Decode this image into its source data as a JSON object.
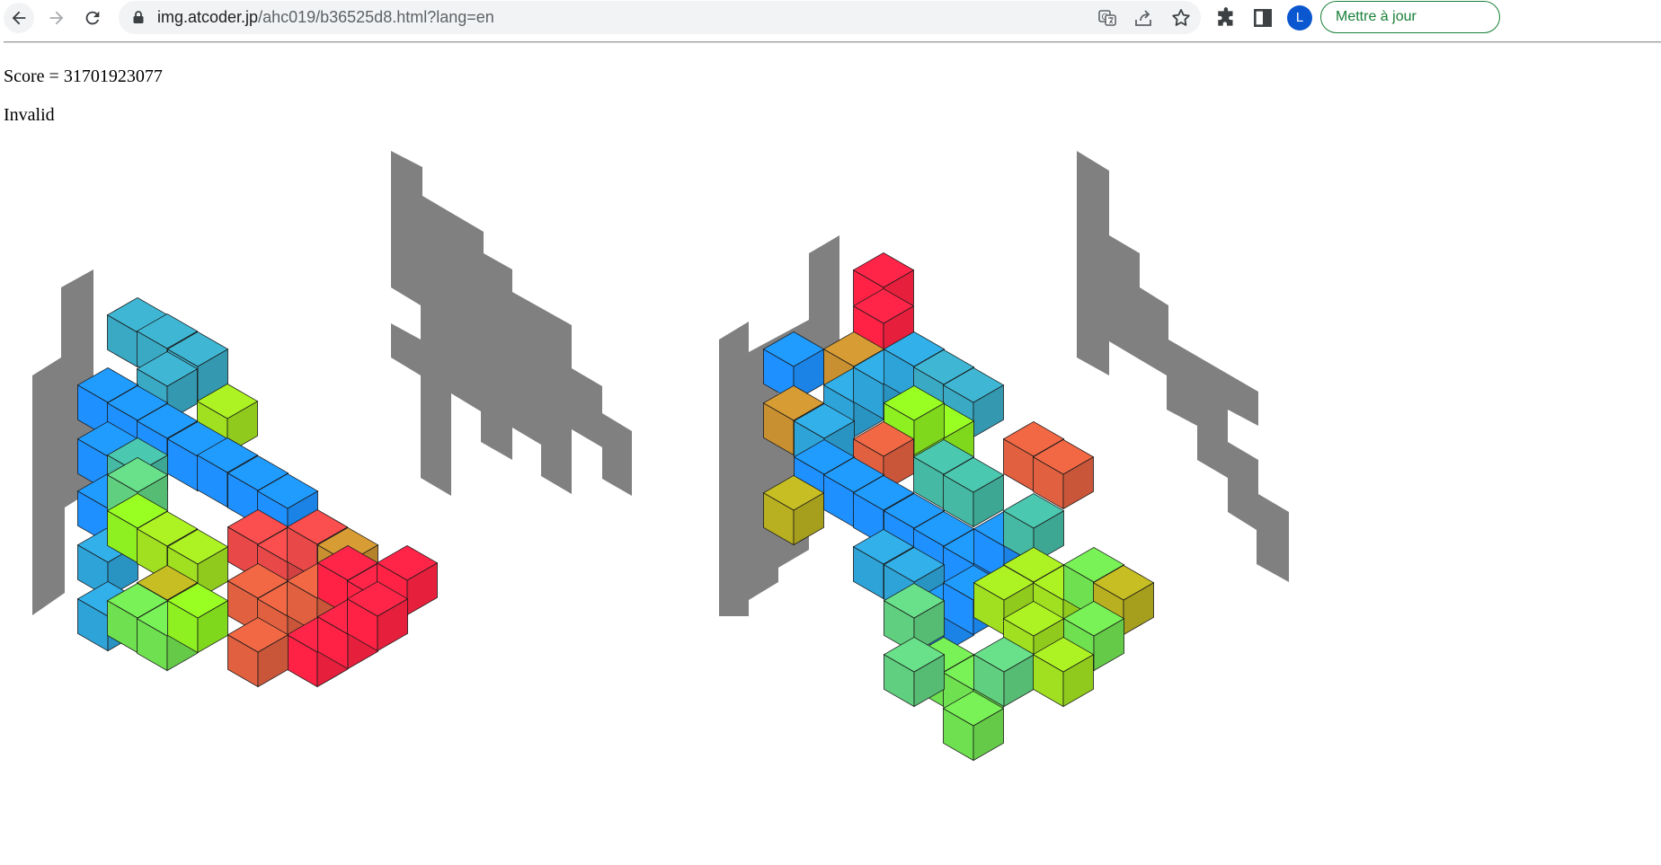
{
  "browser": {
    "url_host": "img.atcoder.jp",
    "url_path": "/ahc019/b36525d8.html?lang=en",
    "update_button_label": "Mettre à jour",
    "avatar_letter": "L",
    "icons": [
      "back-icon",
      "forward-icon",
      "reload-icon",
      "lock-icon",
      "translate-icon",
      "share-icon",
      "bookmark-star-icon",
      "extensions-icon",
      "side-panel-icon"
    ]
  },
  "page": {
    "score_text": "Score = 31701923077",
    "status_text": "Invalid"
  },
  "colors": {
    "silhouette": "#808080",
    "block_palette": [
      "#1e90ff",
      "#2ea3d8",
      "#3aa9c4",
      "#45b9a3",
      "#60d080",
      "#6fe050",
      "#8ef020",
      "#a0e020",
      "#b8b020",
      "#c89030",
      "#e06040",
      "#e84848",
      "#ff2244"
    ]
  }
}
